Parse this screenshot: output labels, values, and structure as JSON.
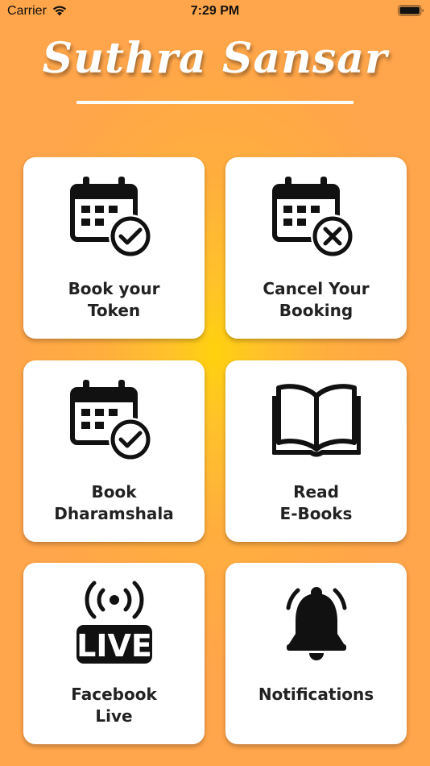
{
  "status_bar": {
    "carrier": "Carrier",
    "time": "7:29 PM"
  },
  "app": {
    "title": "Suthra Sansar"
  },
  "tiles": [
    {
      "label": "Book your\nToken",
      "icon": "calendar-check-icon"
    },
    {
      "label": "Cancel Your\nBooking",
      "icon": "calendar-cancel-icon"
    },
    {
      "label": "Book\nDharamshala",
      "icon": "calendar-check-icon"
    },
    {
      "label": "Read\nE-Books",
      "icon": "open-book-icon"
    },
    {
      "label": "Facebook\nLive",
      "icon": "live-broadcast-icon"
    },
    {
      "label": "Notifications",
      "icon": "bell-icon"
    }
  ],
  "colors": {
    "background_outer": "#ffa54b",
    "background_center": "#ffd10d",
    "tile": "#ffffff",
    "icon": "#111111",
    "label": "#222222"
  }
}
